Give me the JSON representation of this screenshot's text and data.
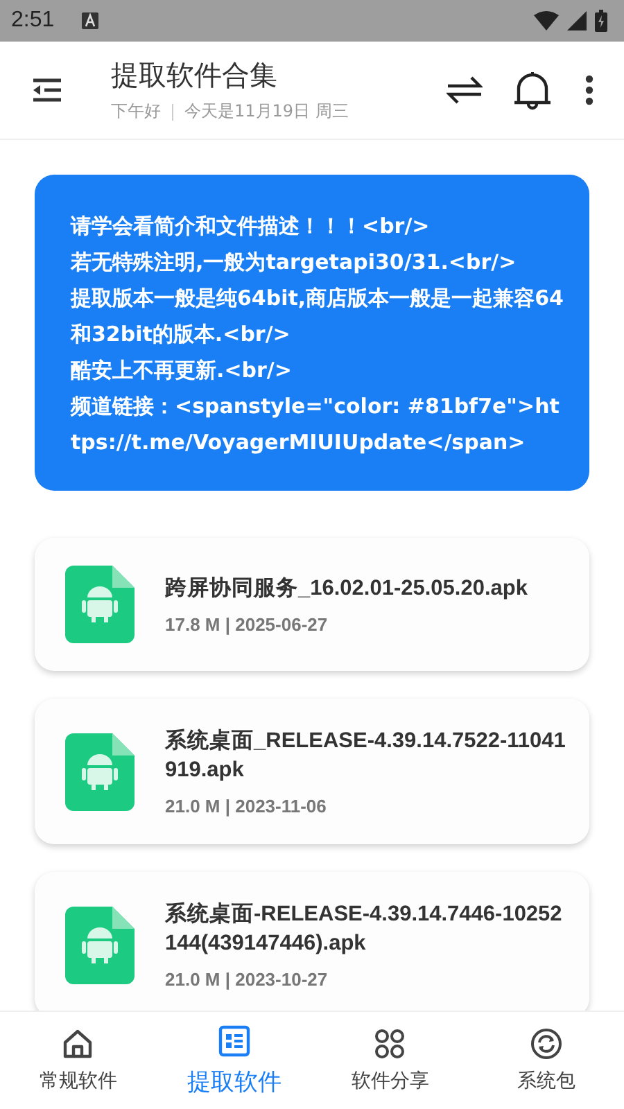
{
  "status_bar": {
    "time": "2:51"
  },
  "header": {
    "title": "提取软件合集",
    "greeting": "下午好",
    "date": "今天是11月19日 周三"
  },
  "notice": {
    "lines": [
      "请学会看简介和文件描述！！！<br/>",
      "若无特殊注明,一般为targetapi30/31.<br/>",
      "提取版本一般是纯64bit,商店版本一般是一起兼容64和32bit的版本.<br/>",
      "酷安上不再更新.<br/>",
      "频道链接：<spanstyle=\"color: #81bf7e\">https://t.me/VoyagerMIUIUpdate</span>"
    ]
  },
  "files": [
    {
      "name": "跨屏协同服务_16.02.01-25.05.20.apk",
      "meta": "17.8 M | 2025-06-27"
    },
    {
      "name": "系统桌面_RELEASE-4.39.14.7522-11041919.apk",
      "meta": "21.0 M | 2023-11-06"
    },
    {
      "name": "系统桌面-RELEASE-4.39.14.7446-10252144(439147446).apk",
      "meta": "21.0 M | 2023-10-27"
    }
  ],
  "bottom_nav": [
    {
      "label": "常规软件",
      "kind": "home",
      "selected": false
    },
    {
      "label": "提取软件",
      "kind": "list",
      "selected": true
    },
    {
      "label": "软件分享",
      "kind": "grid",
      "selected": false
    },
    {
      "label": "系统包",
      "kind": "sync",
      "selected": false
    }
  ]
}
